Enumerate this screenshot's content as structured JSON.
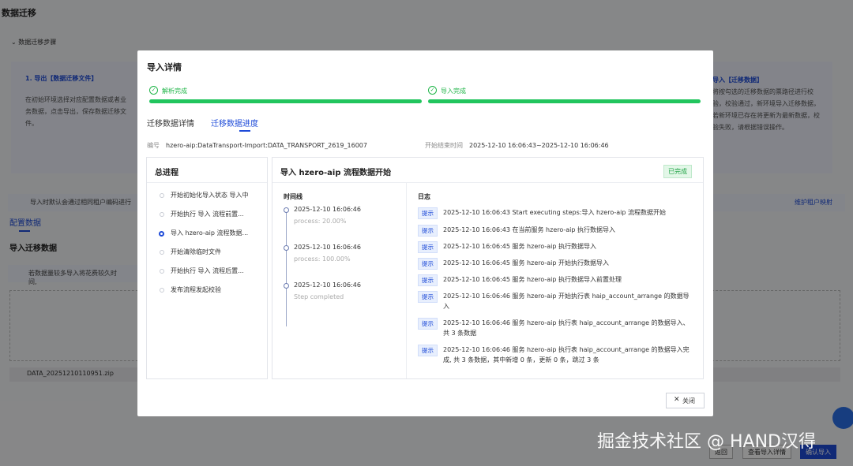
{
  "background": {
    "page_title": "数据迁移",
    "section_title": "数据迁移步骤",
    "step1_title": "1. 导出【数据迁移文件】",
    "step1_text": "在初始环境选择对应配置数据或者业务数据，点击导出，保存数据迁移文件。",
    "step3_title": "导入【迁移数据】",
    "step3_text": "将按勾选的迁移数据的票路径进行校验，校验通过，新环境导入迁移数据，若新环境已存在将更新为最新数据，校验失败，请根据错误操作。",
    "notice": "导入时默认会通过相同租户编码进行",
    "maintain_link": "维护租户映射",
    "tab_config": "配置数据",
    "import_title": "导入迁移数据",
    "notice2": "若数据量较多导入将花费较久时间,",
    "file_name": "DATA_20251210110951.zip",
    "btn_back": "返回",
    "btn_view": "查看导入详情",
    "btn_confirm": "确认导入"
  },
  "watermark": "掘金技术社区 @ HAND汉得",
  "modal": {
    "title": "导入详情",
    "stages": [
      {
        "label": "解析完成",
        "progress": 1.0
      },
      {
        "label": "导入完成",
        "progress": 1.0
      }
    ],
    "tabs": [
      "迁移数据详情",
      "迁移数据进度"
    ],
    "active_tab": 1,
    "meta": {
      "id_label": "编号",
      "id_value": "hzero-aip:DataTransport-Import:DATA_TRANSPORT_2619_16007",
      "time_label": "开始结束时间",
      "time_value": "2025-12-10 16:06:43~2025-12-10 16:06:46"
    },
    "progress_panel": {
      "title": "总进程",
      "items": [
        "开始初始化导入状态 导入中",
        "开始执行 导入 流程前置...",
        "导入 hzero-aip 流程数据...",
        "开始清除临时文件",
        "开始执行 导入 流程后置...",
        "发布流程发起校验"
      ],
      "active_index": 2
    },
    "detail_panel": {
      "title": "导入 hzero-aip 流程数据开始",
      "status_badge": "已完成",
      "timeline_header": "时间线",
      "timeline": [
        {
          "time": "2025-12-10 16:06:46",
          "sub": "process: 20.00%"
        },
        {
          "time": "2025-12-10 16:06:46",
          "sub": "process: 100.00%"
        },
        {
          "time": "2025-12-10 16:06:46",
          "sub": "Step completed"
        }
      ],
      "log_header": "日志",
      "log_tag": "提示",
      "logs": [
        "2025-12-10 16:06:43 Start executing steps:导入 hzero-aip 流程数据开始",
        "2025-12-10 16:06:43 在当前服务 hzero-aip 执行数据导入",
        "2025-12-10 16:06:45 服务 hzero-aip 执行数据导入",
        "2025-12-10 16:06:45 服务 hzero-aip 开始执行数据导入",
        "2025-12-10 16:06:45 服务 hzero-aip 执行数据导入前置处理",
        "2025-12-10 16:06:46 服务 hzero-aip 开始执行表 haip_account_arrange 的数据导入",
        "2025-12-10 16:06:46 服务 hzero-aip 执行表 haip_account_arrange 的数据导入、共 3 条数据",
        "2025-12-10 16:06:46 服务 hzero-aip 执行表 haip_account_arrange 的数据导入完成, 共 3 条数据，其中新增 0 条，更新 0 条，跳过 3 条"
      ]
    },
    "close_label": "关闭"
  }
}
